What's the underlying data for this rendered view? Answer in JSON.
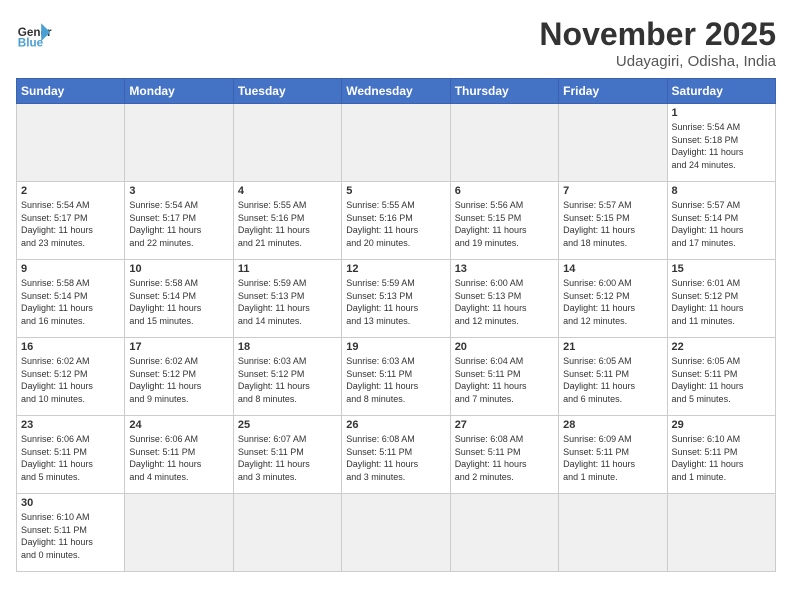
{
  "header": {
    "logo_general": "General",
    "logo_blue": "Blue",
    "month_title": "November 2025",
    "subtitle": "Udayagiri, Odisha, India"
  },
  "days_of_week": [
    "Sunday",
    "Monday",
    "Tuesday",
    "Wednesday",
    "Thursday",
    "Friday",
    "Saturday"
  ],
  "weeks": [
    [
      {
        "day": "",
        "info": "",
        "empty": true
      },
      {
        "day": "",
        "info": "",
        "empty": true
      },
      {
        "day": "",
        "info": "",
        "empty": true
      },
      {
        "day": "",
        "info": "",
        "empty": true
      },
      {
        "day": "",
        "info": "",
        "empty": true
      },
      {
        "day": "",
        "info": "",
        "empty": true
      },
      {
        "day": "1",
        "info": "Sunrise: 5:54 AM\nSunset: 5:18 PM\nDaylight: 11 hours\nand 24 minutes.",
        "empty": false
      }
    ],
    [
      {
        "day": "2",
        "info": "Sunrise: 5:54 AM\nSunset: 5:17 PM\nDaylight: 11 hours\nand 23 minutes.",
        "empty": false
      },
      {
        "day": "3",
        "info": "Sunrise: 5:54 AM\nSunset: 5:17 PM\nDaylight: 11 hours\nand 22 minutes.",
        "empty": false
      },
      {
        "day": "4",
        "info": "Sunrise: 5:55 AM\nSunset: 5:16 PM\nDaylight: 11 hours\nand 21 minutes.",
        "empty": false
      },
      {
        "day": "5",
        "info": "Sunrise: 5:55 AM\nSunset: 5:16 PM\nDaylight: 11 hours\nand 20 minutes.",
        "empty": false
      },
      {
        "day": "6",
        "info": "Sunrise: 5:56 AM\nSunset: 5:15 PM\nDaylight: 11 hours\nand 19 minutes.",
        "empty": false
      },
      {
        "day": "7",
        "info": "Sunrise: 5:57 AM\nSunset: 5:15 PM\nDaylight: 11 hours\nand 18 minutes.",
        "empty": false
      },
      {
        "day": "8",
        "info": "Sunrise: 5:57 AM\nSunset: 5:14 PM\nDaylight: 11 hours\nand 17 minutes.",
        "empty": false
      }
    ],
    [
      {
        "day": "9",
        "info": "Sunrise: 5:58 AM\nSunset: 5:14 PM\nDaylight: 11 hours\nand 16 minutes.",
        "empty": false
      },
      {
        "day": "10",
        "info": "Sunrise: 5:58 AM\nSunset: 5:14 PM\nDaylight: 11 hours\nand 15 minutes.",
        "empty": false
      },
      {
        "day": "11",
        "info": "Sunrise: 5:59 AM\nSunset: 5:13 PM\nDaylight: 11 hours\nand 14 minutes.",
        "empty": false
      },
      {
        "day": "12",
        "info": "Sunrise: 5:59 AM\nSunset: 5:13 PM\nDaylight: 11 hours\nand 13 minutes.",
        "empty": false
      },
      {
        "day": "13",
        "info": "Sunrise: 6:00 AM\nSunset: 5:13 PM\nDaylight: 11 hours\nand 12 minutes.",
        "empty": false
      },
      {
        "day": "14",
        "info": "Sunrise: 6:00 AM\nSunset: 5:12 PM\nDaylight: 11 hours\nand 12 minutes.",
        "empty": false
      },
      {
        "day": "15",
        "info": "Sunrise: 6:01 AM\nSunset: 5:12 PM\nDaylight: 11 hours\nand 11 minutes.",
        "empty": false
      }
    ],
    [
      {
        "day": "16",
        "info": "Sunrise: 6:02 AM\nSunset: 5:12 PM\nDaylight: 11 hours\nand 10 minutes.",
        "empty": false
      },
      {
        "day": "17",
        "info": "Sunrise: 6:02 AM\nSunset: 5:12 PM\nDaylight: 11 hours\nand 9 minutes.",
        "empty": false
      },
      {
        "day": "18",
        "info": "Sunrise: 6:03 AM\nSunset: 5:12 PM\nDaylight: 11 hours\nand 8 minutes.",
        "empty": false
      },
      {
        "day": "19",
        "info": "Sunrise: 6:03 AM\nSunset: 5:11 PM\nDaylight: 11 hours\nand 8 minutes.",
        "empty": false
      },
      {
        "day": "20",
        "info": "Sunrise: 6:04 AM\nSunset: 5:11 PM\nDaylight: 11 hours\nand 7 minutes.",
        "empty": false
      },
      {
        "day": "21",
        "info": "Sunrise: 6:05 AM\nSunset: 5:11 PM\nDaylight: 11 hours\nand 6 minutes.",
        "empty": false
      },
      {
        "day": "22",
        "info": "Sunrise: 6:05 AM\nSunset: 5:11 PM\nDaylight: 11 hours\nand 5 minutes.",
        "empty": false
      }
    ],
    [
      {
        "day": "23",
        "info": "Sunrise: 6:06 AM\nSunset: 5:11 PM\nDaylight: 11 hours\nand 5 minutes.",
        "empty": false
      },
      {
        "day": "24",
        "info": "Sunrise: 6:06 AM\nSunset: 5:11 PM\nDaylight: 11 hours\nand 4 minutes.",
        "empty": false
      },
      {
        "day": "25",
        "info": "Sunrise: 6:07 AM\nSunset: 5:11 PM\nDaylight: 11 hours\nand 3 minutes.",
        "empty": false
      },
      {
        "day": "26",
        "info": "Sunrise: 6:08 AM\nSunset: 5:11 PM\nDaylight: 11 hours\nand 3 minutes.",
        "empty": false
      },
      {
        "day": "27",
        "info": "Sunrise: 6:08 AM\nSunset: 5:11 PM\nDaylight: 11 hours\nand 2 minutes.",
        "empty": false
      },
      {
        "day": "28",
        "info": "Sunrise: 6:09 AM\nSunset: 5:11 PM\nDaylight: 11 hours\nand 1 minute.",
        "empty": false
      },
      {
        "day": "29",
        "info": "Sunrise: 6:10 AM\nSunset: 5:11 PM\nDaylight: 11 hours\nand 1 minute.",
        "empty": false
      }
    ],
    [
      {
        "day": "30",
        "info": "Sunrise: 6:10 AM\nSunset: 5:11 PM\nDaylight: 11 hours\nand 0 minutes.",
        "empty": false
      },
      {
        "day": "",
        "info": "",
        "empty": true
      },
      {
        "day": "",
        "info": "",
        "empty": true
      },
      {
        "day": "",
        "info": "",
        "empty": true
      },
      {
        "day": "",
        "info": "",
        "empty": true
      },
      {
        "day": "",
        "info": "",
        "empty": true
      },
      {
        "day": "",
        "info": "",
        "empty": true
      }
    ]
  ]
}
